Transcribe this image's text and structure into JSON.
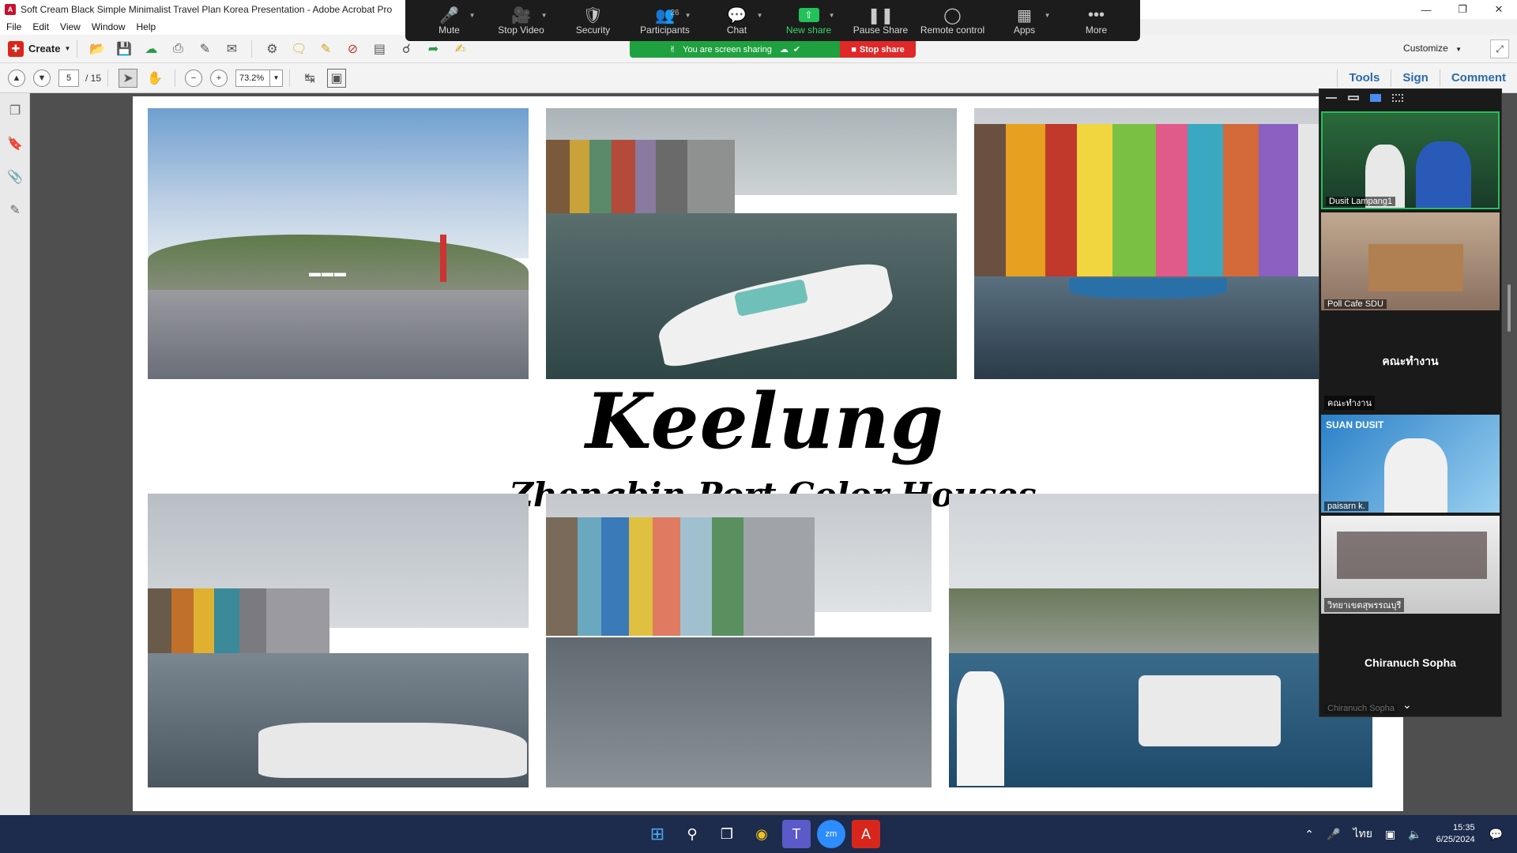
{
  "window": {
    "title": "Soft Cream Black Simple Minimalist Travel Plan Korea Presentation - Adobe Acrobat Pro"
  },
  "menu": [
    "File",
    "Edit",
    "View",
    "Window",
    "Help"
  ],
  "toolbar": {
    "create_label": "Create",
    "customize_label": "Customize"
  },
  "nav": {
    "page_current": "5",
    "page_total": "/ 15",
    "zoom": "73.2%"
  },
  "right_tabs": [
    "Tools",
    "Sign",
    "Comment"
  ],
  "zoom_bar": {
    "items": [
      {
        "label": "Mute",
        "icon": "microphone-icon"
      },
      {
        "label": "Stop Video",
        "icon": "video-camera-icon"
      },
      {
        "label": "Security",
        "icon": "shield-icon"
      },
      {
        "label": "Participants",
        "icon": "participants-icon",
        "badge": "26"
      },
      {
        "label": "Chat",
        "icon": "chat-bubble-icon"
      },
      {
        "label": "New share",
        "icon": "share-screen-icon"
      },
      {
        "label": "Pause Share",
        "icon": "pause-icon"
      },
      {
        "label": "Remote control",
        "icon": "mouse-icon"
      },
      {
        "label": "Apps",
        "icon": "apps-icon"
      },
      {
        "label": "More",
        "icon": "more-dots-icon"
      }
    ],
    "sharing_banner": "You are screen sharing",
    "stop_share": "Stop share"
  },
  "slide": {
    "title": "Keelung",
    "subtitle": "Zhengbin Port Color Houses"
  },
  "participants": {
    "tiles": [
      {
        "name": "Dusit Lampang1"
      },
      {
        "name": "Poll Cafe SDU"
      },
      {
        "name": "คณะทำงาน",
        "center_name": "คณะทำงาน"
      },
      {
        "name": "paisarn k.",
        "overlay_text": "SUAN DUSIT"
      },
      {
        "name": "วิทยาเขตสุพรรณบุรี"
      },
      {
        "name": "Chiranuch Sopha",
        "center_name": "Chiranuch Sopha"
      }
    ]
  },
  "taskbar": {
    "icons": [
      "windows-start-icon",
      "search-icon",
      "task-view-icon",
      "chrome-icon",
      "teams-icon",
      "zoom-app-icon",
      "acrobat-icon"
    ],
    "language": "ไทย",
    "time": "15:35",
    "date": "6/25/2024"
  },
  "colors": {
    "zoom_bar_bg": "#1c1c1c",
    "sharing_green": "#1fa13f",
    "stop_red": "#e02828",
    "acrobat_red": "#d9261c",
    "tab_blue": "#2c6aa8",
    "taskbar_bg": "#1d2b4c"
  }
}
